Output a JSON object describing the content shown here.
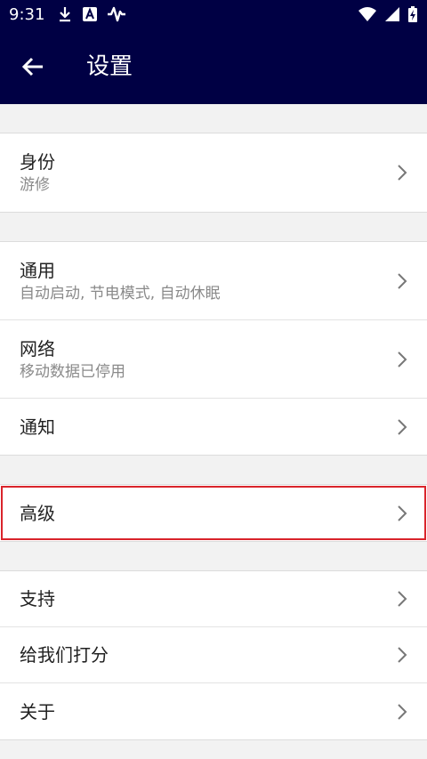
{
  "status_bar": {
    "time": "9:31",
    "icons": [
      "download-icon",
      "a-badge-icon",
      "pulse-icon",
      "wifi-icon",
      "signal-icon",
      "battery-charging-icon"
    ]
  },
  "app_bar": {
    "title": "设置",
    "back_icon": "arrow-left-icon"
  },
  "sections": [
    {
      "items": [
        {
          "label": "身份",
          "sub": "游修"
        }
      ]
    },
    {
      "items": [
        {
          "label": "通用",
          "sub": "自动启动, 节电模式, 自动休眠"
        },
        {
          "label": "网络",
          "sub": "移动数据已停用"
        },
        {
          "label": "通知"
        }
      ]
    },
    {
      "items": [
        {
          "label": "高级"
        }
      ]
    },
    {
      "items": [
        {
          "label": "支持"
        },
        {
          "label": "给我们打分"
        },
        {
          "label": "关于"
        }
      ]
    }
  ],
  "colors": {
    "bar": "#000044",
    "highlight": "#d9242b"
  }
}
